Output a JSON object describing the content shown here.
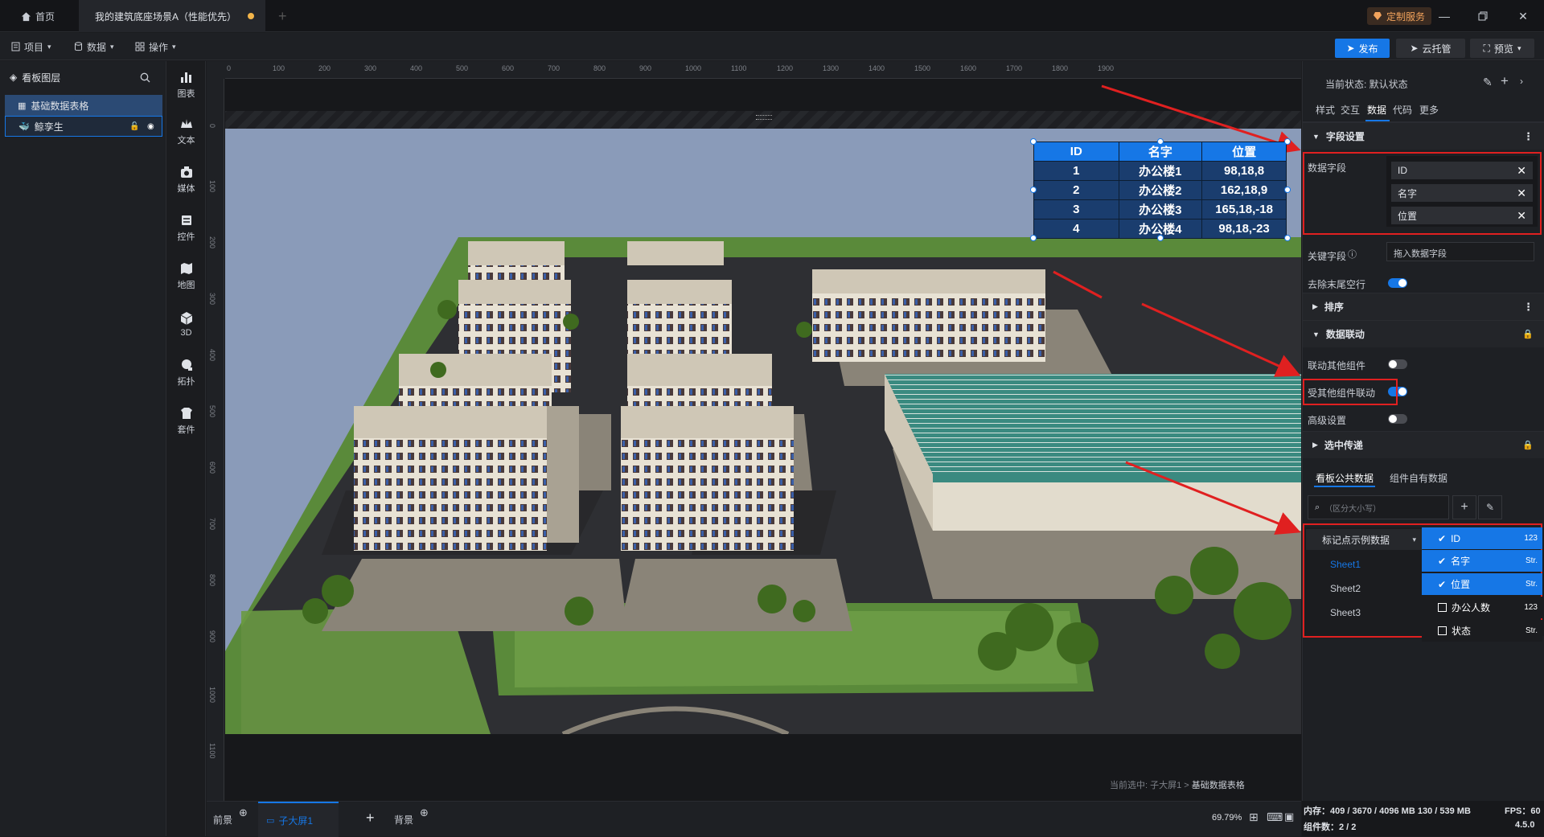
{
  "titlebar": {
    "home": "首页",
    "scene_tab": "我的建筑底座场景A（性能优先）",
    "custom_service": "定制服务"
  },
  "toolbar": {
    "project": "项目",
    "data": "数据",
    "operate": "操作",
    "publish": "发布",
    "cloud": "云托管",
    "preview": "预览"
  },
  "layers": {
    "title": "看板图层",
    "items": [
      {
        "label": "基础数据表格"
      },
      {
        "label": "鲸孪生"
      }
    ]
  },
  "tools": [
    {
      "label": "图表",
      "icon": "chart-icon"
    },
    {
      "label": "文本",
      "icon": "text-icon"
    },
    {
      "label": "媒体",
      "icon": "media-icon"
    },
    {
      "label": "控件",
      "icon": "control-icon"
    },
    {
      "label": "地图",
      "icon": "map-icon"
    },
    {
      "label": "3D",
      "icon": "cube-icon"
    },
    {
      "label": "拓扑",
      "icon": "topology-icon"
    },
    {
      "label": "套件",
      "icon": "kit-icon"
    }
  ],
  "ruler": {
    "h": [
      "0",
      "100",
      "200",
      "300",
      "400",
      "500",
      "600",
      "700",
      "800",
      "900",
      "1000",
      "1100",
      "1200",
      "1300",
      "1400",
      "1500",
      "1600",
      "1700",
      "1800",
      "1900"
    ],
    "v": [
      "0",
      "100",
      "200",
      "300",
      "400",
      "500",
      "600",
      "700",
      "800",
      "900",
      "1000",
      "1100"
    ]
  },
  "table": {
    "headers": [
      "ID",
      "名字",
      "位置"
    ],
    "rows": [
      [
        "1",
        "办公楼1",
        "98,18,8"
      ],
      [
        "2",
        "办公楼2",
        "162,18,9"
      ],
      [
        "3",
        "办公楼3",
        "165,18,-18"
      ],
      [
        "4",
        "办公楼4",
        "98,18,-23"
      ]
    ]
  },
  "canvas": {
    "status_prefix": "当前选中: 子大屏1 >",
    "status_selected": "基础数据表格"
  },
  "bottom": {
    "front": "前景",
    "sub1": "子大屏1",
    "back": "背景",
    "zoom": "69.79%"
  },
  "rpanel": {
    "state_label": "当前状态: 默认状态",
    "tabs": [
      "样式",
      "交互",
      "数据",
      "代码",
      "更多"
    ],
    "field_section": "字段设置",
    "data_field_label": "数据字段",
    "fields": [
      "ID",
      "名字",
      "位置"
    ],
    "key_field_label": "关键字段",
    "key_field_placeholder": "拖入数据字段",
    "trim_label": "去除末尾空行",
    "sort_section": "排序",
    "link_section": "数据联动",
    "link_other": "联动其他组件",
    "linked_by": "受其他组件联动",
    "advanced": "高级设置",
    "select_section": "选中传递",
    "sub_tabs": [
      "看板公共数据",
      "组件自有数据"
    ],
    "search_placeholder": "（区分大小写）",
    "dataset": "标记点示例数据",
    "sheets": [
      "Sheet1",
      "Sheet2",
      "Sheet3"
    ],
    "columns": [
      {
        "name": "ID",
        "type": "123",
        "checked": true
      },
      {
        "name": "名字",
        "type": "Str.",
        "checked": true
      },
      {
        "name": "位置",
        "type": "Str.",
        "checked": true
      },
      {
        "name": "办公人数",
        "type": "123",
        "checked": false
      },
      {
        "name": "状态",
        "type": "Str.",
        "checked": false
      }
    ]
  },
  "statusbar": {
    "memory": "内存：409 / 3670 / 4096 MB  130 / 539 MB",
    "fps": "FPS：60",
    "components": "组件数：2 / 2",
    "version": "4.5.0"
  },
  "colors": {
    "accent": "#1677e6",
    "highlight": "#e02020",
    "warning": "#f3b54a"
  }
}
